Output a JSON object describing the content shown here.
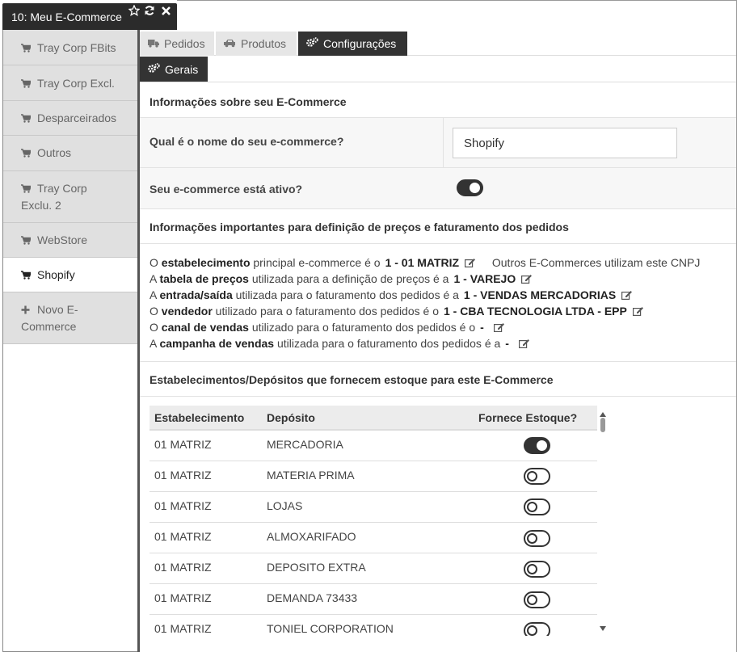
{
  "window": {
    "title": "10: Meu E-Commerce"
  },
  "sidebar": {
    "items": [
      {
        "label": "Tray Corp FBits",
        "icon": "cart-icon"
      },
      {
        "label": "Tray Corp Excl.",
        "icon": "cart-icon"
      },
      {
        "label": "Desparceirados",
        "icon": "cart-icon"
      },
      {
        "label": "Outros",
        "icon": "cart-icon"
      },
      {
        "label": "Tray Corp Exclu. 2",
        "icon": "cart-icon"
      },
      {
        "label": "WebStore",
        "icon": "cart-icon"
      },
      {
        "label": "Shopify",
        "icon": "cart-icon"
      },
      {
        "label": "Novo E-Commerce",
        "icon": "plus-icon"
      }
    ]
  },
  "tabs": [
    {
      "label": "Pedidos",
      "icon": "truck-icon"
    },
    {
      "label": "Produtos",
      "icon": "car-icon"
    },
    {
      "label": "Configurações",
      "icon": "gears-icon"
    }
  ],
  "subtab": {
    "label": "Gerais",
    "icon": "gears-icon"
  },
  "general": {
    "section_title": "Informações sobre seu E-Commerce",
    "name_question": "Qual é o nome do seu e-commerce?",
    "name_value": "Shopify",
    "active_question": "Seu e-commerce está ativo?",
    "active": true
  },
  "pricing": {
    "section_title": "Informações importantes para definição de preços e faturamento dos pedidos",
    "lines": [
      {
        "pre": "O ",
        "bold": "estabelecimento",
        "post": " principal e-commerce é o",
        "value": "1 - 01 MATRIZ",
        "extra": "Outros E-Commerces utilizam este CNPJ"
      },
      {
        "pre": "A ",
        "bold": "tabela de preços",
        "post": " utilizada para a definição de preços é a",
        "value": "1 - VAREJO",
        "extra": ""
      },
      {
        "pre": "A ",
        "bold": "entrada/saída",
        "post": " utilizada para o faturamento dos pedidos é a",
        "value": "1 - VENDAS MERCADORIAS",
        "extra": ""
      },
      {
        "pre": "O ",
        "bold": "vendedor",
        "post": " utilizado para o faturamento dos pedidos é o",
        "value": "1 - CBA TECNOLOGIA LTDA - EPP",
        "extra": ""
      },
      {
        "pre": "O ",
        "bold": "canal de vendas",
        "post": " utilizado para o faturamento dos pedidos é o",
        "value": "-",
        "extra": ""
      },
      {
        "pre": "A ",
        "bold": "campanha de vendas",
        "post": " utilizada para o faturamento dos pedidos é a",
        "value": "-",
        "extra": ""
      }
    ]
  },
  "stock": {
    "section_title": "Estabelecimentos/Depósitos que fornecem estoque para este E-Commerce",
    "headers": {
      "estab": "Estabelecimento",
      "deposito": "Depósito",
      "fornece": "Fornece Estoque?"
    },
    "rows": [
      {
        "estab": "01 MATRIZ",
        "deposito": "MERCADORIA",
        "on": true
      },
      {
        "estab": "01 MATRIZ",
        "deposito": "MATERIA PRIMA",
        "on": false
      },
      {
        "estab": "01 MATRIZ",
        "deposito": "LOJAS",
        "on": false
      },
      {
        "estab": "01 MATRIZ",
        "deposito": "ALMOXARIFADO",
        "on": false
      },
      {
        "estab": "01 MATRIZ",
        "deposito": "DEPOSITO EXTRA",
        "on": false
      },
      {
        "estab": "01 MATRIZ",
        "deposito": "DEMANDA 73433",
        "on": false
      },
      {
        "estab": "01 MATRIZ",
        "deposito": "TONIEL CORPORATION",
        "on": false
      }
    ]
  },
  "colors": {
    "dark": "#333333",
    "tab_inactive": "#e6e6e6",
    "sidebar_inactive": "#e0e0e0"
  }
}
